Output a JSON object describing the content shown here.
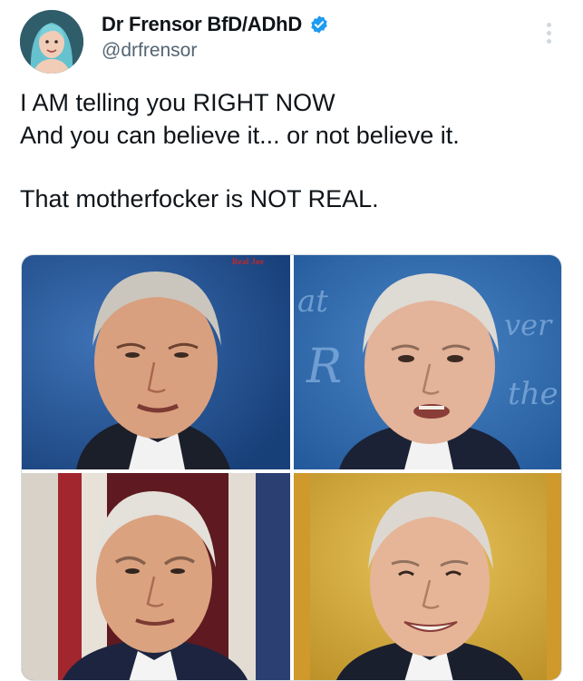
{
  "user": {
    "display_name": "Dr Frensor BfD/ADhD",
    "handle": "@drfrensor",
    "verified": true,
    "avatar_icon": "avatar-icon"
  },
  "tweet": {
    "lines": [
      "I AM telling you RIGHT NOW",
      "And you can believe it... or not believe it.",
      "That motherfocker is NOT REAL."
    ]
  },
  "media": {
    "photo_count": 4,
    "watermark": "Real Joe",
    "backdrop_text": [
      "at",
      "R",
      "ver",
      "the"
    ]
  },
  "colors": {
    "text": "#0f1419",
    "muted": "#536471",
    "verified": "#1d9bf0",
    "watermark": "#c62828"
  }
}
